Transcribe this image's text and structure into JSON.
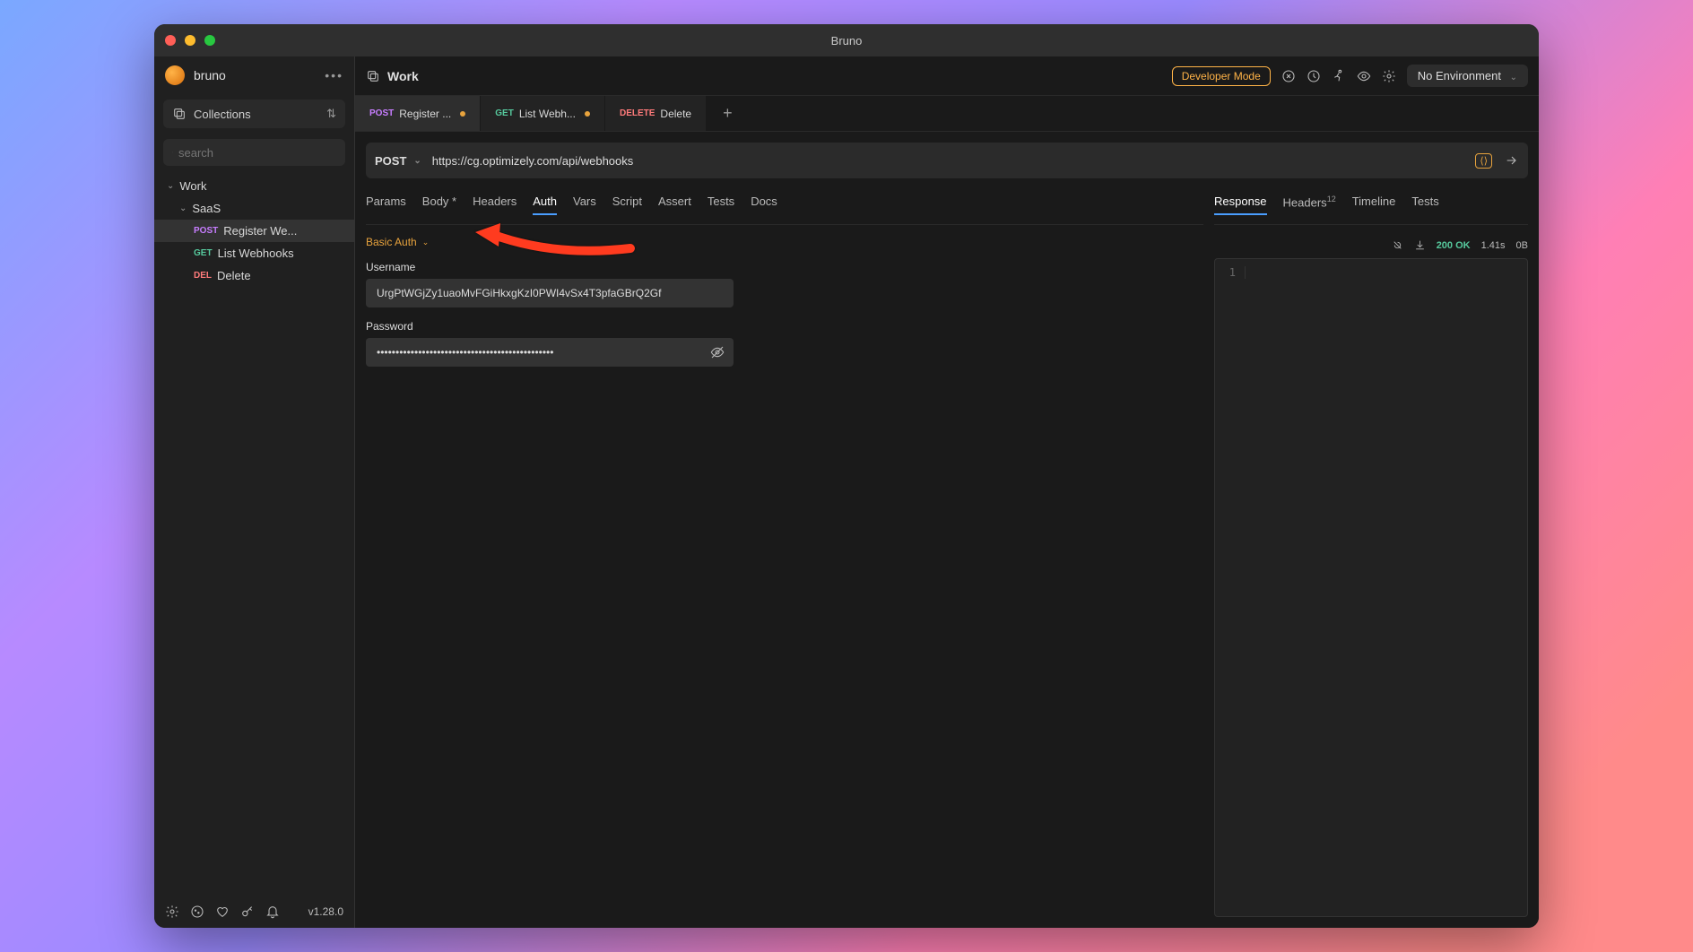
{
  "window": {
    "title": "Bruno"
  },
  "sidebar": {
    "workspace": "bruno",
    "collections_label": "Collections",
    "search_placeholder": "search",
    "tree": {
      "work": "Work",
      "saas": "SaaS",
      "items": [
        {
          "method": "POST",
          "label": "Register We..."
        },
        {
          "method": "GET",
          "label": "List Webhooks"
        },
        {
          "method": "DEL",
          "label": "Delete"
        }
      ]
    },
    "version": "v1.28.0"
  },
  "topbar": {
    "crumb": "Work",
    "dev_mode": "Developer Mode",
    "env": "No Environment"
  },
  "tabs": [
    {
      "method": "POST",
      "label": "Register ...",
      "dirty": true,
      "active": true
    },
    {
      "method": "GET",
      "label": "List Webh...",
      "dirty": true
    },
    {
      "method": "DELETE",
      "label": "Delete"
    }
  ],
  "urlbar": {
    "method": "POST",
    "url": "https://cg.optimizely.com/api/webhooks"
  },
  "request_tabs": [
    "Params",
    "Body *",
    "Headers",
    "Auth",
    "Vars",
    "Script",
    "Assert",
    "Tests",
    "Docs"
  ],
  "request_tab_active": "Auth",
  "auth": {
    "type": "Basic Auth",
    "username_label": "Username",
    "username_value": "UrgPtWGjZy1uaoMvFGiHkxgKzI0PWI4vSx4T3pfaGBrQ2Gf",
    "password_label": "Password",
    "password_value": "***********************************************"
  },
  "response_tabs": [
    "Response",
    "Headers",
    "Timeline",
    "Tests"
  ],
  "response_headers_count": "12",
  "response": {
    "status": "200 OK",
    "time": "1.41s",
    "size": "0B",
    "line_number": "1"
  }
}
